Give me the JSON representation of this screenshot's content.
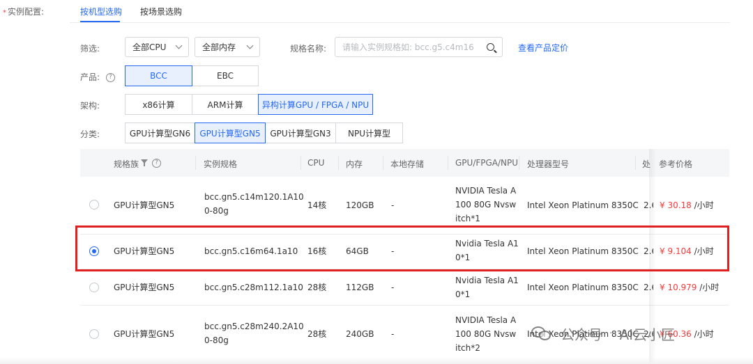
{
  "form": {
    "required_mark": "*",
    "field_label": "实例配置:"
  },
  "tabs": [
    {
      "label": "按机型选购",
      "active": true
    },
    {
      "label": "按场景选购",
      "active": false
    }
  ],
  "filter": {
    "label": "筛选:",
    "cpu_select": "全部CPU",
    "memory_select": "全部内存",
    "spec_name_label": "规格名称:",
    "search_placeholder": "请输入实例规格如: bcc.g5.c4m16",
    "pricing_link": "查看产品定价"
  },
  "product": {
    "label": "产品:",
    "options": [
      "BCC",
      "EBC"
    ],
    "selected": "BCC"
  },
  "architecture": {
    "label": "架构:",
    "options": [
      "x86计算",
      "ARM计算",
      "异构计算GPU / FPGA / NPU"
    ],
    "selected": "异构计算GPU / FPGA / NPU"
  },
  "category": {
    "label": "分类:",
    "options": [
      "GPU计算型GN6",
      "GPU计算型GN5",
      "GPU计算型GN3",
      "NPU计算型"
    ],
    "selected": "GPU计算型GN5"
  },
  "table": {
    "headers": {
      "family": "规格族",
      "spec": "实例规格",
      "cpu": "CPU",
      "memory": "内存",
      "local_storage": "本地存储",
      "accelerator": "GPU/FPGA/NPU",
      "processor": "处理器型号",
      "freq_truncated": "处",
      "price": "参考价格"
    },
    "price_unit": "/小时",
    "rows": [
      {
        "selected": false,
        "family": "GPU计算型GN5",
        "spec_l1": "bcc.gn5.c14m120.1A10",
        "spec_l2": "0-80g",
        "cpu": "14核",
        "memory": "120GB",
        "storage": "-",
        "acc_l1": "NVIDIA Tesla A",
        "acc_l2": "100 80G Nvsw",
        "acc_l3": "itch*1",
        "processor": "Intel Xeon Platinum 8350C",
        "freq": "2.6",
        "price": "¥ 30.18"
      },
      {
        "selected": true,
        "family": "GPU计算型GN5",
        "spec_l1": "bcc.gn5.c16m64.1a10",
        "spec_l2": "",
        "cpu": "16核",
        "memory": "64GB",
        "storage": "-",
        "acc_l1": "Nvidia Tesla A1",
        "acc_l2": "0*1",
        "acc_l3": "",
        "processor": "Intel Xeon Platinum 8350C",
        "freq": "2.6",
        "price": "¥ 9.104"
      },
      {
        "selected": false,
        "family": "GPU计算型GN5",
        "spec_l1": "bcc.gn5.c28m112.1a10",
        "spec_l2": "",
        "cpu": "28核",
        "memory": "112GB",
        "storage": "-",
        "acc_l1": "Nvidia Tesla A1",
        "acc_l2": "0*1",
        "acc_l3": "",
        "processor": "Intel Xeon Platinum 8350C",
        "freq": "2.6",
        "price": "¥ 10.979"
      },
      {
        "selected": false,
        "family": "GPU计算型GN5",
        "spec_l1": "bcc.gn5.c28m240.2A10",
        "spec_l2": "0-80g",
        "cpu": "28核",
        "memory": "240GB",
        "storage": "-",
        "acc_l1": "NVIDIA Tesla A",
        "acc_l2": "100 80G Nvsw",
        "acc_l3": "itch*2",
        "processor": "Intel Xeon Platinum 8350C",
        "freq": "2.6",
        "price": "¥ 60.36"
      }
    ]
  },
  "watermark": {
    "text_a": "公众号",
    "dot": "·",
    "text_b": "AI云小匠"
  },
  "colors": {
    "accent": "#2468f2",
    "price": "#f33b3b",
    "highlight": "#e02020"
  }
}
